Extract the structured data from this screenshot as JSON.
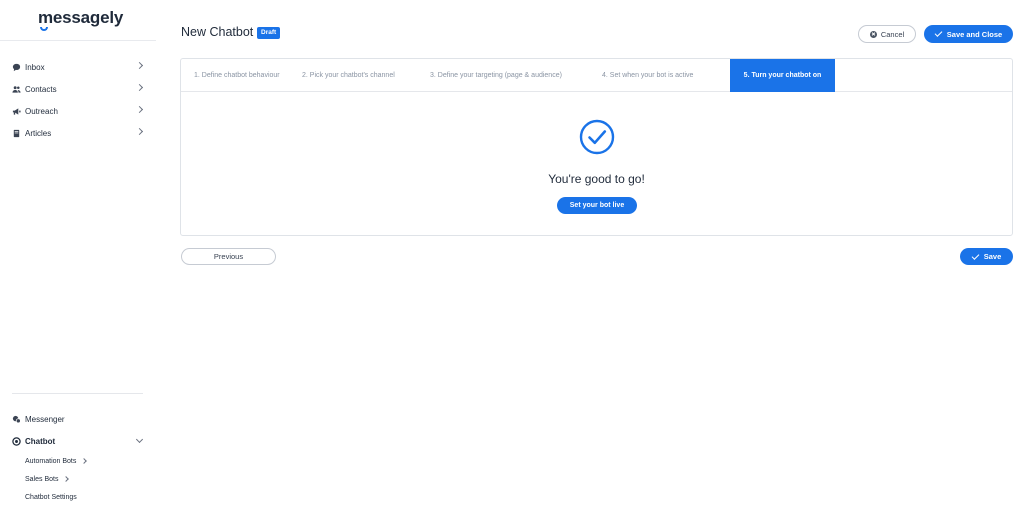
{
  "brand": {
    "name": "messagely",
    "accent": "#1a73e8"
  },
  "sidebar": {
    "items": [
      {
        "label": "Inbox",
        "icon": "chat-bubble-icon"
      },
      {
        "label": "Contacts",
        "icon": "users-icon"
      },
      {
        "label": "Outreach",
        "icon": "megaphone-icon"
      },
      {
        "label": "Articles",
        "icon": "book-icon"
      }
    ],
    "bottom": {
      "messenger": {
        "label": "Messenger",
        "icon": "messenger-icon"
      },
      "chatbot": {
        "label": "Chatbot",
        "icon": "chatbot-icon"
      },
      "subitems": [
        {
          "label": "Automation Bots"
        },
        {
          "label": "Sales Bots"
        },
        {
          "label": "Chatbot Settings"
        }
      ]
    }
  },
  "header": {
    "title": "New Chatbot",
    "badge": "Draft",
    "cancel_label": "Cancel",
    "save_close_label": "Save and Close"
  },
  "wizard": {
    "tabs": [
      {
        "label": "1. Define chatbot behaviour"
      },
      {
        "label": "2. Pick your chatbot's channel"
      },
      {
        "label": "3. Define your targeting (page & audience)"
      },
      {
        "label": "4. Set when your bot is active"
      },
      {
        "label": "5. Turn your chatbot on"
      }
    ],
    "active_tab": 4,
    "message": "You're good to go!",
    "live_button": "Set your bot live"
  },
  "footer": {
    "previous_label": "Previous",
    "save_label": "Save"
  }
}
